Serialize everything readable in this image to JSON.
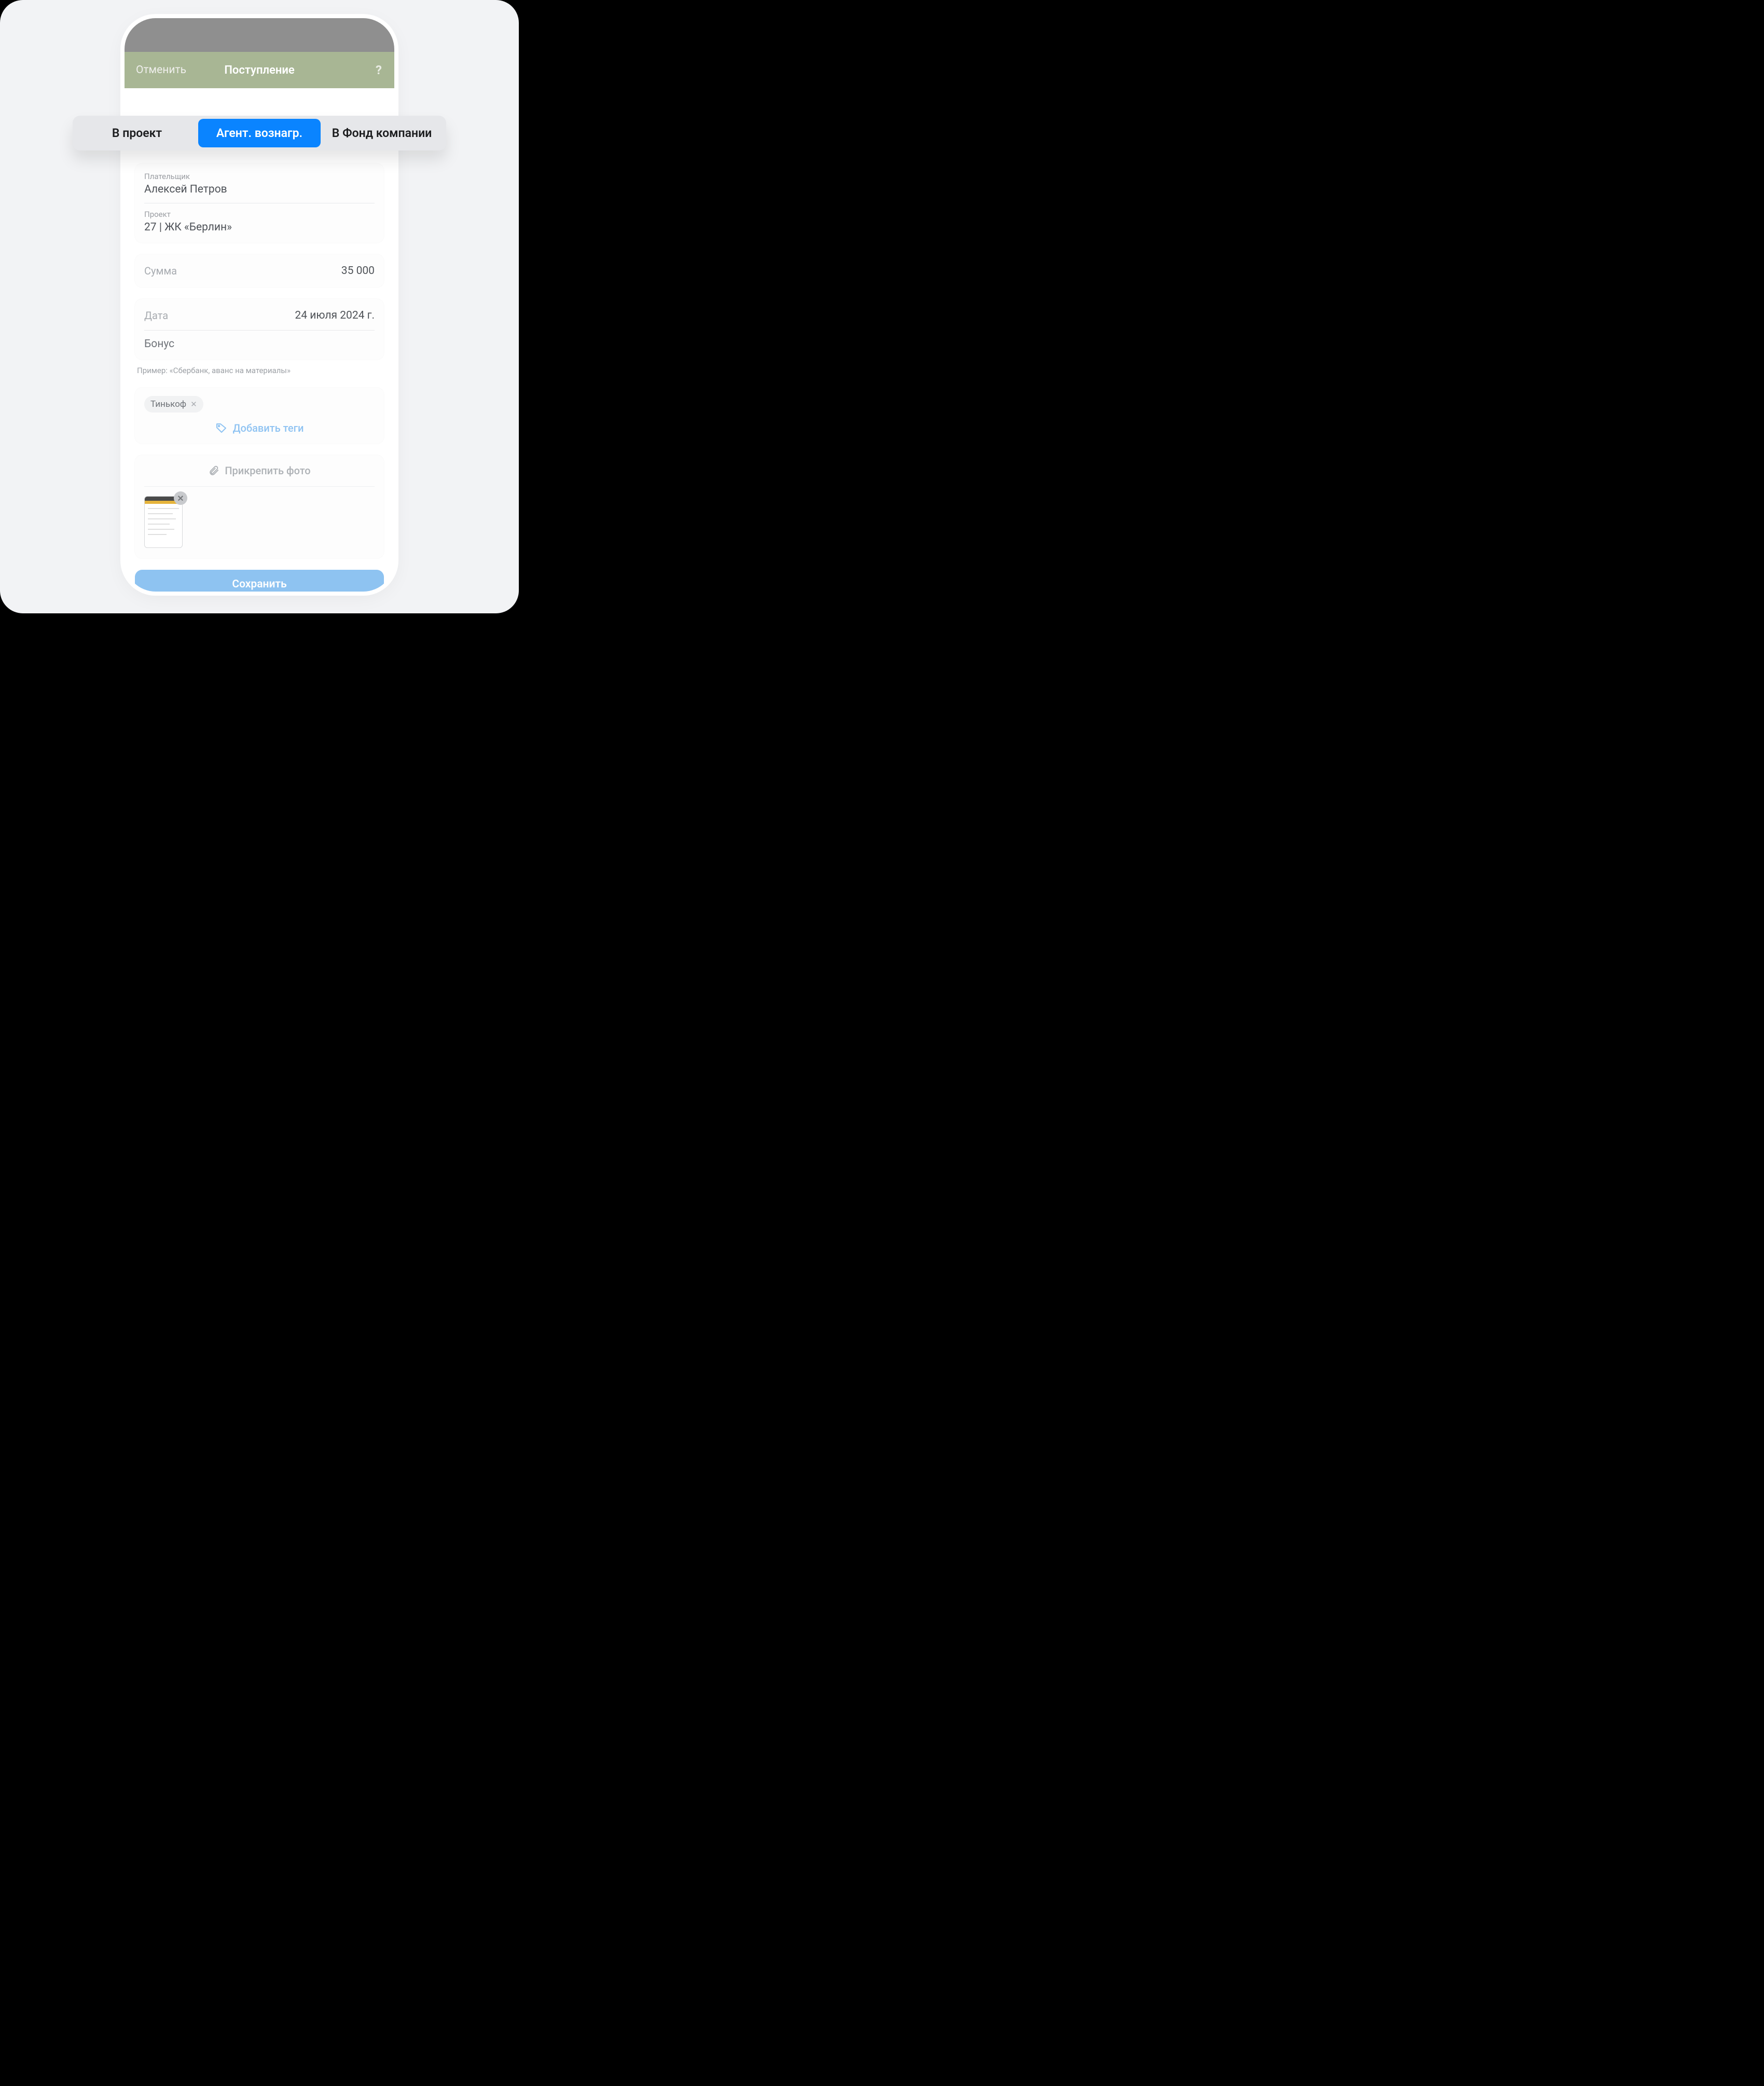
{
  "header": {
    "cancel": "Отменить",
    "title": "Поступление",
    "help": "?"
  },
  "segments": {
    "a": "В проект",
    "b": "Агент. вознагр.",
    "c": "В Фонд компании"
  },
  "payer": {
    "label": "Плательщик",
    "value": "Алексей Петров"
  },
  "project": {
    "label": "Проект",
    "value": "27 | ЖК «Берлин»"
  },
  "amount": {
    "label": "Сумма",
    "value": "35 000"
  },
  "date": {
    "label": "Дата",
    "value": "24 июля 2024 г."
  },
  "note": {
    "value": "Бонус",
    "hint": "Пример: «Сбербанк, аванс на материалы»"
  },
  "tags": {
    "chip": "Тинькоф",
    "add": "Добавить теги"
  },
  "attach": {
    "label": "Прикрепить фото"
  },
  "save": "Сохранить"
}
